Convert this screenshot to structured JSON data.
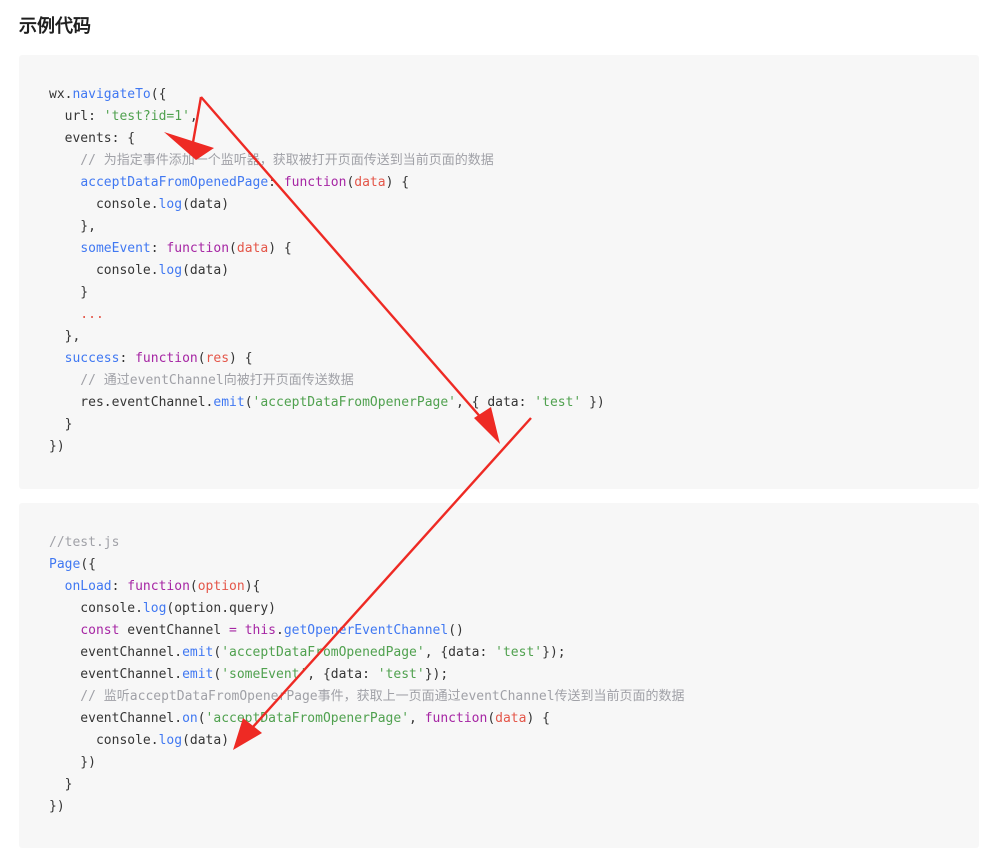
{
  "section_title": "示例代码",
  "code_block_1": {
    "lines": [
      [
        {
          "t": "wx.",
          "c": ""
        },
        {
          "t": "navigateTo",
          "c": "fn"
        },
        {
          "t": "({",
          "c": ""
        }
      ],
      [
        {
          "t": "  url: ",
          "c": ""
        },
        {
          "t": "'test?id=1'",
          "c": "str"
        },
        {
          "t": ",",
          "c": ""
        }
      ],
      [
        {
          "t": "  events: {",
          "c": ""
        }
      ],
      [
        {
          "t": "    // 为指定事件添加一个监听器，获取被打开页面传送到当前页面的数据",
          "c": "com"
        }
      ],
      [
        {
          "t": "    ",
          "c": ""
        },
        {
          "t": "acceptDataFromOpenedPage",
          "c": "fn"
        },
        {
          "t": ": ",
          "c": ""
        },
        {
          "t": "function",
          "c": "kw"
        },
        {
          "t": "(",
          "c": ""
        },
        {
          "t": "data",
          "c": "param"
        },
        {
          "t": ") {",
          "c": ""
        }
      ],
      [
        {
          "t": "      console.",
          "c": ""
        },
        {
          "t": "log",
          "c": "fn"
        },
        {
          "t": "(data)",
          "c": ""
        }
      ],
      [
        {
          "t": "    },",
          "c": ""
        }
      ],
      [
        {
          "t": "    ",
          "c": ""
        },
        {
          "t": "someEvent",
          "c": "fn"
        },
        {
          "t": ": ",
          "c": ""
        },
        {
          "t": "function",
          "c": "kw"
        },
        {
          "t": "(",
          "c": ""
        },
        {
          "t": "data",
          "c": "param"
        },
        {
          "t": ") {",
          "c": ""
        }
      ],
      [
        {
          "t": "      console.",
          "c": ""
        },
        {
          "t": "log",
          "c": "fn"
        },
        {
          "t": "(data)",
          "c": ""
        }
      ],
      [
        {
          "t": "    }",
          "c": ""
        }
      ],
      [
        {
          "t": "    ...",
          "c": "ellipsis"
        }
      ],
      [
        {
          "t": "  },",
          "c": ""
        }
      ],
      [
        {
          "t": "  ",
          "c": ""
        },
        {
          "t": "success",
          "c": "fn"
        },
        {
          "t": ": ",
          "c": ""
        },
        {
          "t": "function",
          "c": "kw"
        },
        {
          "t": "(",
          "c": ""
        },
        {
          "t": "res",
          "c": "param"
        },
        {
          "t": ") {",
          "c": ""
        }
      ],
      [
        {
          "t": "    // 通过eventChannel向被打开页面传送数据",
          "c": "com"
        }
      ],
      [
        {
          "t": "    res.eventChannel.",
          "c": ""
        },
        {
          "t": "emit",
          "c": "fn"
        },
        {
          "t": "(",
          "c": ""
        },
        {
          "t": "'acceptDataFromOpenerPage'",
          "c": "str"
        },
        {
          "t": ", { data: ",
          "c": ""
        },
        {
          "t": "'test'",
          "c": "str"
        },
        {
          "t": " })",
          "c": ""
        }
      ],
      [
        {
          "t": "  }",
          "c": ""
        }
      ],
      [
        {
          "t": "})",
          "c": ""
        }
      ]
    ]
  },
  "code_block_2": {
    "lines": [
      [
        {
          "t": "//test.js",
          "c": "com"
        }
      ],
      [
        {
          "t": "Page",
          "c": "fn"
        },
        {
          "t": "({",
          "c": ""
        }
      ],
      [
        {
          "t": "  ",
          "c": ""
        },
        {
          "t": "onLoad",
          "c": "fn"
        },
        {
          "t": ": ",
          "c": ""
        },
        {
          "t": "function",
          "c": "kw"
        },
        {
          "t": "(",
          "c": ""
        },
        {
          "t": "option",
          "c": "param"
        },
        {
          "t": "){",
          "c": ""
        }
      ],
      [
        {
          "t": "    console.",
          "c": ""
        },
        {
          "t": "log",
          "c": "fn"
        },
        {
          "t": "(option.query)",
          "c": ""
        }
      ],
      [
        {
          "t": "    ",
          "c": ""
        },
        {
          "t": "const",
          "c": "kw"
        },
        {
          "t": " eventChannel ",
          "c": ""
        },
        {
          "t": "=",
          "c": "kw"
        },
        {
          "t": " ",
          "c": ""
        },
        {
          "t": "this",
          "c": "kw"
        },
        {
          "t": ".",
          "c": ""
        },
        {
          "t": "getOpenerEventChannel",
          "c": "fn"
        },
        {
          "t": "()",
          "c": ""
        }
      ],
      [
        {
          "t": "    eventChannel.",
          "c": ""
        },
        {
          "t": "emit",
          "c": "fn"
        },
        {
          "t": "(",
          "c": ""
        },
        {
          "t": "'acceptDataFromOpenedPage'",
          "c": "str"
        },
        {
          "t": ", {data: ",
          "c": ""
        },
        {
          "t": "'test'",
          "c": "str"
        },
        {
          "t": "});",
          "c": ""
        }
      ],
      [
        {
          "t": "    eventChannel.",
          "c": ""
        },
        {
          "t": "emit",
          "c": "fn"
        },
        {
          "t": "(",
          "c": ""
        },
        {
          "t": "'someEvent'",
          "c": "str"
        },
        {
          "t": ", {data: ",
          "c": ""
        },
        {
          "t": "'test'",
          "c": "str"
        },
        {
          "t": "});",
          "c": ""
        }
      ],
      [
        {
          "t": "    // 监听acceptDataFromOpenerPage事件，获取上一页面通过eventChannel传送到当前页面的数据",
          "c": "com"
        }
      ],
      [
        {
          "t": "    eventChannel.",
          "c": ""
        },
        {
          "t": "on",
          "c": "fn"
        },
        {
          "t": "(",
          "c": ""
        },
        {
          "t": "'acceptDataFromOpenerPage'",
          "c": "str"
        },
        {
          "t": ", ",
          "c": ""
        },
        {
          "t": "function",
          "c": "kw"
        },
        {
          "t": "(",
          "c": ""
        },
        {
          "t": "data",
          "c": "param"
        },
        {
          "t": ") {",
          "c": ""
        }
      ],
      [
        {
          "t": "      console.",
          "c": ""
        },
        {
          "t": "log",
          "c": "fn"
        },
        {
          "t": "(data)",
          "c": ""
        }
      ],
      [
        {
          "t": "    })",
          "c": ""
        }
      ],
      [
        {
          "t": "  }",
          "c": ""
        }
      ],
      [
        {
          "t": "})",
          "c": ""
        }
      ]
    ]
  },
  "annotation_color": "#ee2a24"
}
